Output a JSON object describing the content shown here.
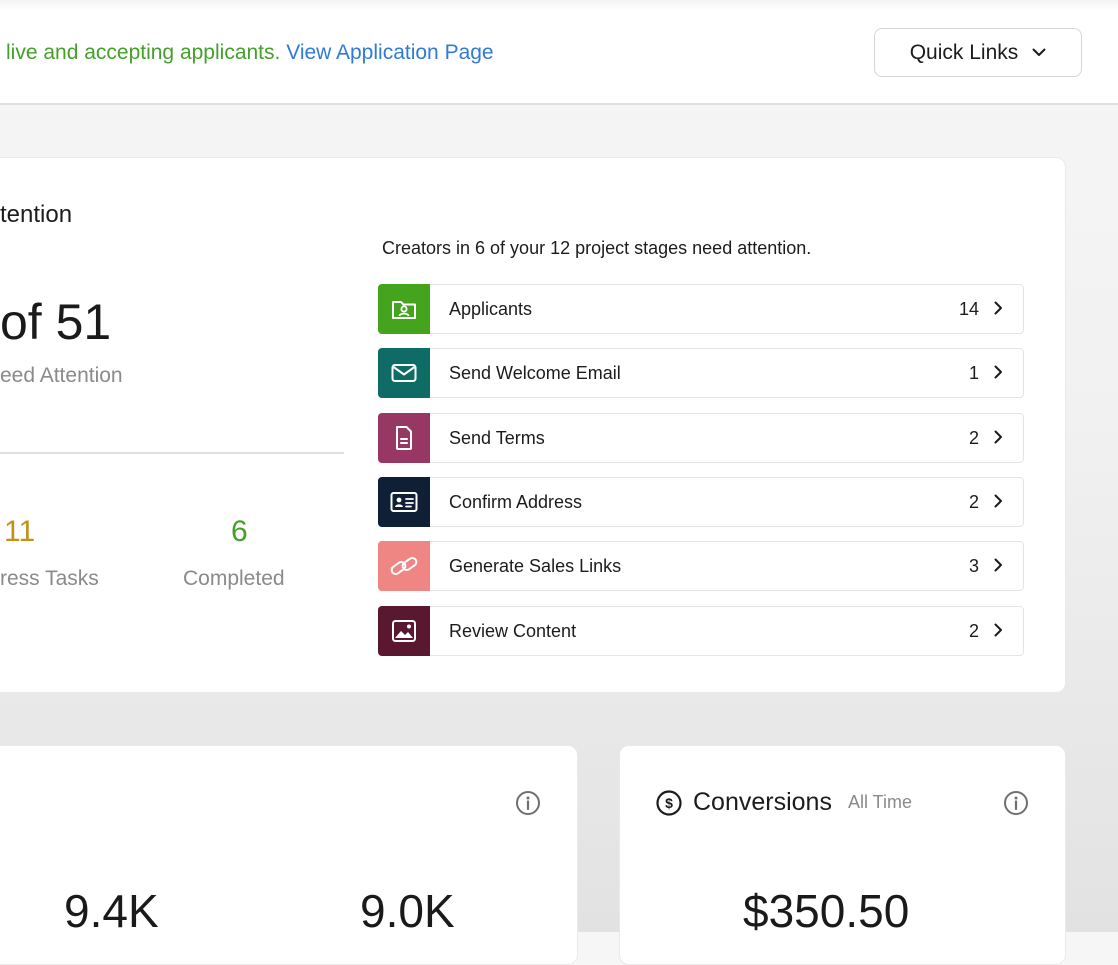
{
  "banner": {
    "status_text": "live and accepting applicants.",
    "link_text": "View Application Page"
  },
  "quick_links": {
    "label": "Quick Links",
    "icon": "chevron-down-icon"
  },
  "attention": {
    "title": "tention",
    "big_value": "of 51",
    "subtitle": "eed Attention",
    "stats": [
      {
        "value": "11",
        "label": "ress Tasks",
        "color": "#c4901a"
      },
      {
        "value": "6",
        "label": "Completed",
        "color": "#43a12a"
      }
    ]
  },
  "stages": {
    "intro": "Creators in 6 of your 12 project stages need attention.",
    "items": [
      {
        "label": "Applicants",
        "count": "14",
        "icon": "folder-user-icon",
        "color": "#45a41e"
      },
      {
        "label": "Send Welcome Email",
        "count": "1",
        "icon": "envelope-icon",
        "color": "#0e6b65"
      },
      {
        "label": "Send Terms",
        "count": "2",
        "icon": "document-icon",
        "color": "#963863"
      },
      {
        "label": "Confirm Address",
        "count": "2",
        "icon": "id-card-icon",
        "color": "#0f1f36"
      },
      {
        "label": "Generate Sales Links",
        "count": "3",
        "icon": "link-icon",
        "color": "#ef8684"
      },
      {
        "label": "Review Content",
        "count": "2",
        "icon": "image-icon",
        "color": "#5a1730"
      }
    ]
  },
  "metrics": {
    "values": [
      "9.4K",
      "9.0K"
    ]
  },
  "conversions": {
    "title": "Conversions",
    "period": "All Time",
    "value": "$350.50",
    "icon": "dollar-circle-icon"
  }
}
